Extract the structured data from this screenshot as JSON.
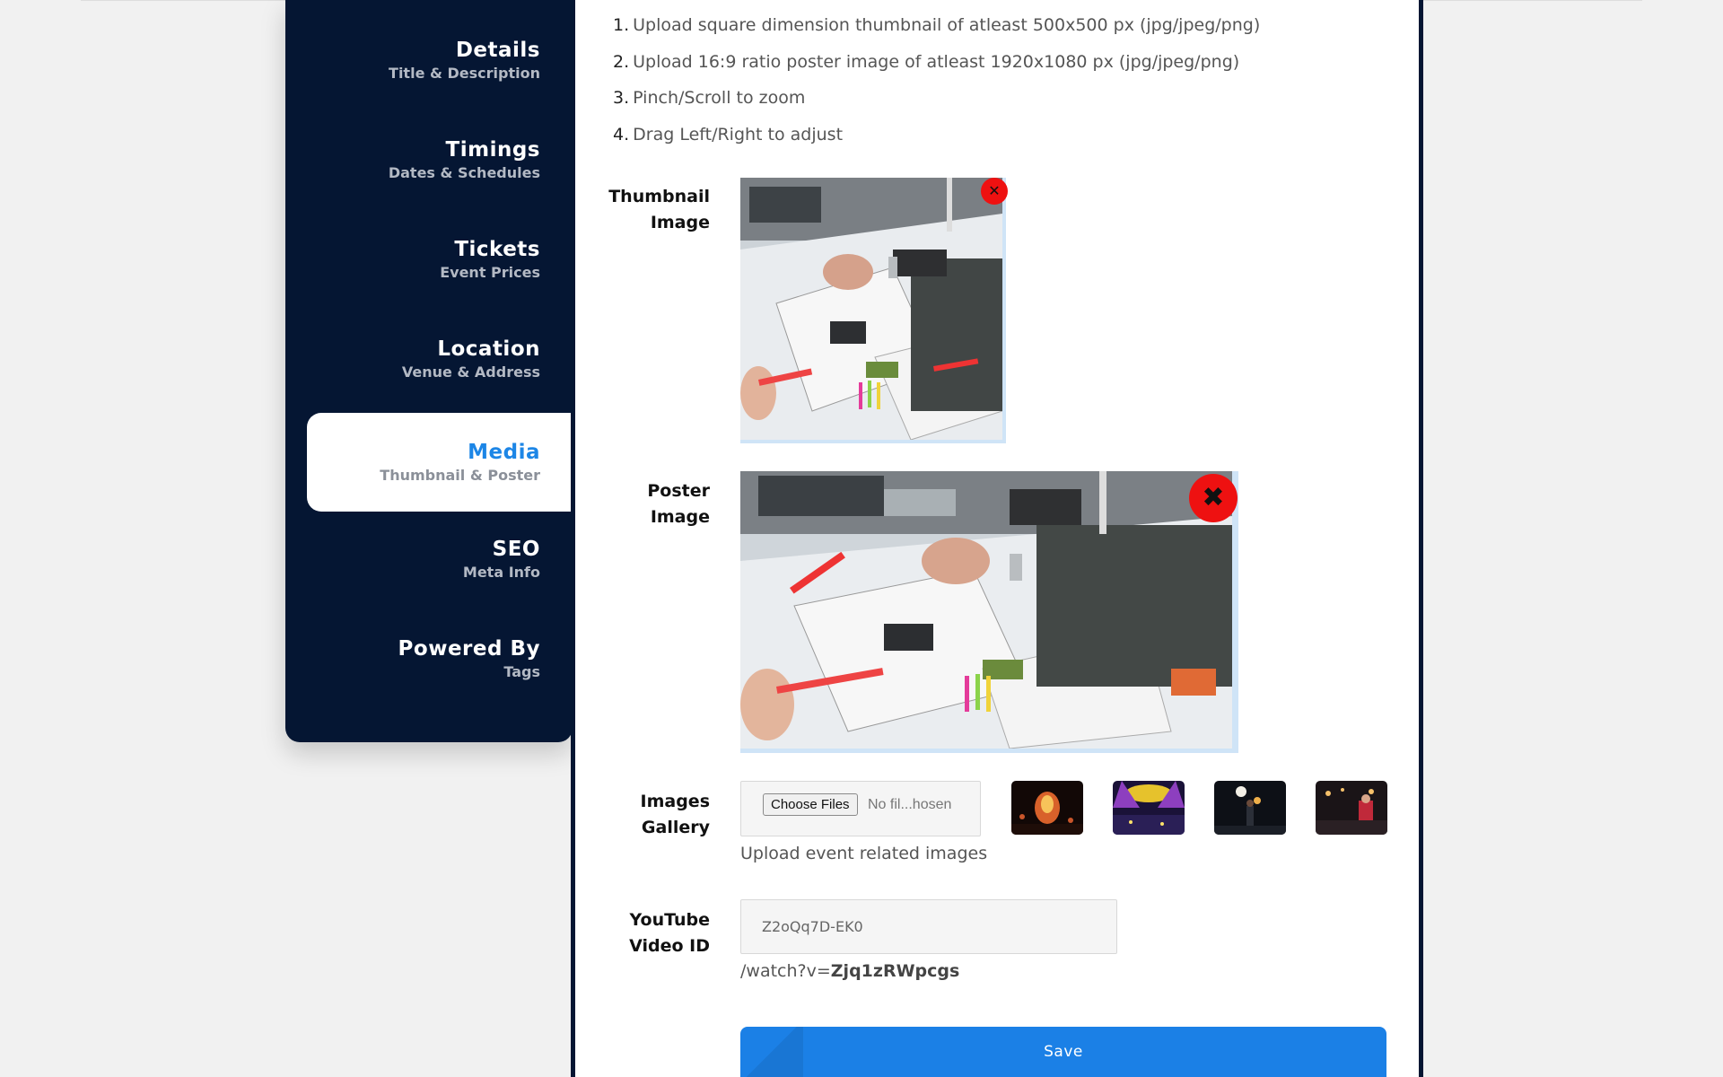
{
  "sidebar": {
    "items": [
      {
        "title": "Details",
        "subtitle": "Title & Description"
      },
      {
        "title": "Timings",
        "subtitle": "Dates & Schedules"
      },
      {
        "title": "Tickets",
        "subtitle": "Event Prices"
      },
      {
        "title": "Location",
        "subtitle": "Venue & Address"
      },
      {
        "title": "Media",
        "subtitle": "Thumbnail & Poster",
        "active": true
      },
      {
        "title": "SEO",
        "subtitle": "Meta Info"
      },
      {
        "title": "Powered By",
        "subtitle": "Tags"
      }
    ]
  },
  "instructions": [
    {
      "num": "1.",
      "text": "Upload square dimension thumbnail of atleast 500x500 px (jpg/jpeg/png)"
    },
    {
      "num": "2.",
      "text": "Upload 16:9 ratio poster image of atleast 1920x1080 px (jpg/jpeg/png)"
    },
    {
      "num": "3.",
      "text": "Pinch/Scroll to zoom"
    },
    {
      "num": "4.",
      "text": "Drag Left/Right to adjust"
    }
  ],
  "thumbnail": {
    "label_line1": "Thumbnail",
    "label_line2": "Image"
  },
  "poster": {
    "label_line1": "Poster",
    "label_line2": "Image"
  },
  "gallery": {
    "label_line1": "Images",
    "label_line2": "Gallery",
    "choose_label": "Choose Files",
    "no_file_text": "No fil...hosen",
    "help": "Upload event related images"
  },
  "youtube": {
    "label_line1": "YouTube",
    "label_line2": "Video ID",
    "placeholder": "Z2oQq7D-EK0",
    "hint_prefix": "/watch?v=",
    "hint_id": "Zjq1zRWpcgs"
  },
  "save_label": "Save",
  "icons": {
    "remove": "close-icon"
  },
  "colors": {
    "sidebar_bg": "#051633",
    "accent": "#1d86e6",
    "save_button": "#1b80e6",
    "remove": "#ee1111"
  }
}
